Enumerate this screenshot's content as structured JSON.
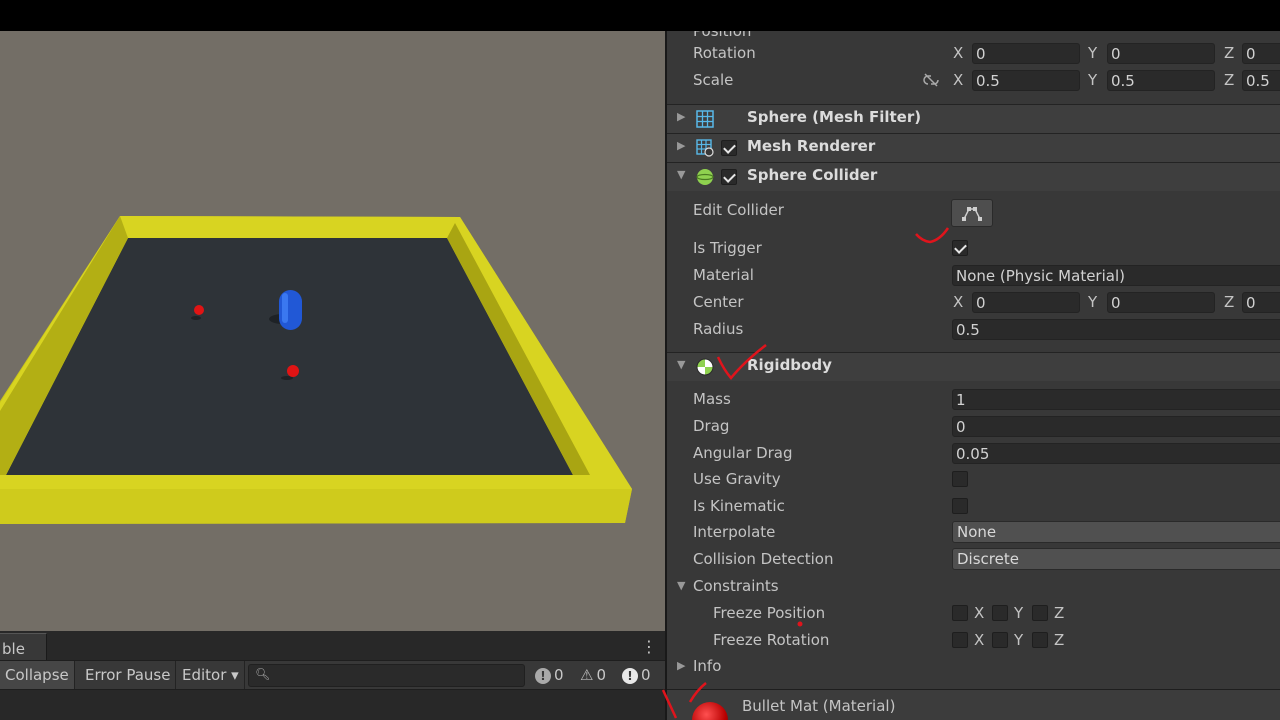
{
  "inspector": {
    "transform": {
      "position_label": "Position",
      "rotation": {
        "label": "Rotation",
        "x": "0",
        "y": "0",
        "z": "0"
      },
      "scale": {
        "label": "Scale",
        "x": "0.5",
        "y": "0.5",
        "z": "0.5"
      },
      "axis_x": "X",
      "axis_y": "Y",
      "axis_z": "Z"
    },
    "components": {
      "mesh_filter": "Sphere (Mesh Filter)",
      "mesh_renderer": "Mesh Renderer",
      "sphere_collider": "Sphere Collider",
      "rigidbody": "Rigidbody"
    },
    "collider": {
      "edit_label": "Edit Collider",
      "is_trigger_label": "Is Trigger",
      "is_trigger": true,
      "material_label": "Material",
      "material_value": "None (Physic Material)",
      "center_label": "Center",
      "center": {
        "x": "0",
        "y": "0",
        "z": "0"
      },
      "radius_label": "Radius",
      "radius": "0.5"
    },
    "rigidbody": {
      "mass_label": "Mass",
      "mass": "1",
      "drag_label": "Drag",
      "drag": "0",
      "angular_drag_label": "Angular Drag",
      "angular_drag": "0.05",
      "use_gravity_label": "Use Gravity",
      "use_gravity": false,
      "is_kinematic_label": "Is Kinematic",
      "is_kinematic": false,
      "interpolate_label": "Interpolate",
      "interpolate": "None",
      "collision_label": "Collision Detection",
      "collision": "Discrete",
      "constraints_label": "Constraints",
      "freeze_position_label": "Freeze Position",
      "freeze_rotation_label": "Freeze Rotation",
      "info_label": "Info"
    },
    "material": {
      "name": "Bullet Mat (Material)"
    }
  },
  "console": {
    "tab_label": "ble",
    "collapse": "Collapse",
    "error_pause": "Error Pause",
    "editor": "Editor ▾",
    "log_count": "0",
    "warn_count": "0",
    "error_count": "0"
  },
  "colors": {
    "wall": "#d9d51e",
    "floor": "#2e3338",
    "player": "#2158d6",
    "bullet": "#e01414",
    "annotation": "#e0141c"
  }
}
